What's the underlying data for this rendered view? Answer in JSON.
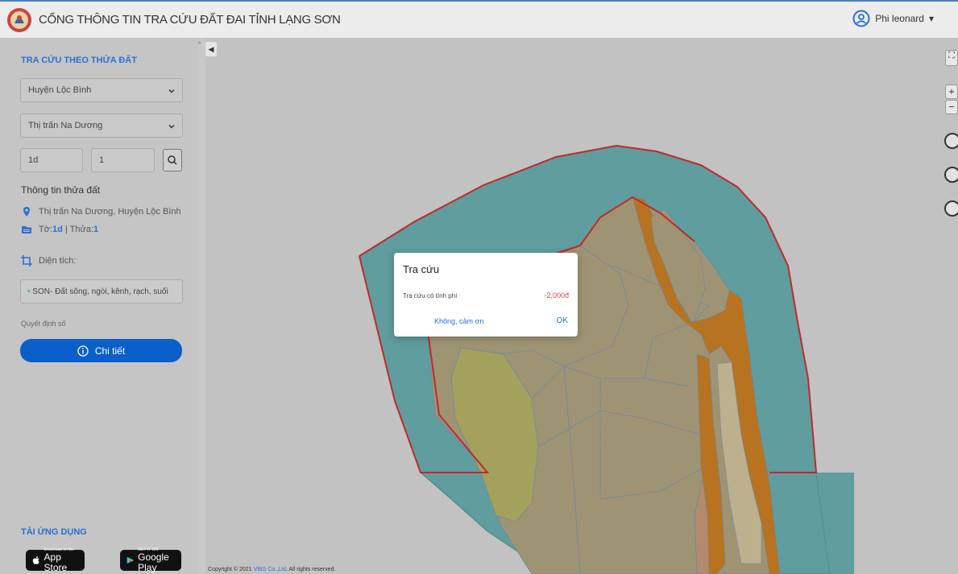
{
  "header": {
    "title": "CỔNG THÔNG TIN TRA CỨU ĐẤT ĐAI TỈNH LẠNG SƠN",
    "user_name": "Phi leonard",
    "user_caret": "▾"
  },
  "sidebar": {
    "section_title": "TRA CỨU THEO THỬA ĐẤT",
    "district_select": "Huyện Lộc Bình",
    "commune_select": "Thị trấn Na Dương",
    "map_sheet_value": "1d",
    "parcel_value": "1",
    "info_title": "Thông tin thửa đất",
    "address": "Thị trấn Na Dương, Huyện Lộc Bình",
    "sheet_label": "Tờ:",
    "sheet_value": "1d",
    "parcel_sep": "| Thửa:",
    "parcel_no": "1",
    "area_label": "Diện tích:",
    "land_type": "SON- Đất sông, ngòi, kênh, rạch, suối",
    "decision_label": "Quyết định số",
    "detail_button": "Chi tiết",
    "app_title": "TẢI ỨNG DỤNG",
    "app_store_small": "Download on the",
    "app_store_big": "App Store",
    "google_play_small": "GET IT ON",
    "google_play_big": "Google Play"
  },
  "map": {
    "collapse_icon": "◀",
    "zoom_in": "+",
    "zoom_out": "−",
    "fullscreen": "⛶"
  },
  "footer": {
    "prefix": "Copyright © 2021",
    "company": "VBIS Co.,Ltd",
    "suffix": ". All rights reserved."
  },
  "dialog": {
    "title": "Tra cứu",
    "fee_label": "Tra cứu có tính phí",
    "fee_value": "-2,000đ",
    "no_button": "Không, cảm ơn",
    "ok_button": "OK"
  },
  "colors": {
    "accent": "#0b5fc8",
    "river": "#5f9d9e",
    "boundary": "#c0292c",
    "parcel_tan": "#9e9474",
    "parcel_orange": "#b7731f",
    "parcel_olive": "#a4a15c"
  }
}
